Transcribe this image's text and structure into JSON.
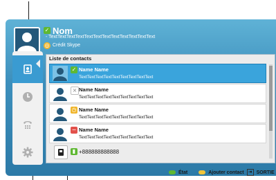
{
  "profile": {
    "name": "Nom",
    "mood": "- TextTextTextTextTextTextTextTextTextTextTextText",
    "credit": "Crédit Skype"
  },
  "contacts": {
    "header": "Liste de contacts",
    "items": [
      {
        "name": "Name Name",
        "mood": "TextTextTextTextTextTextTextTextText",
        "status": "online"
      },
      {
        "name": "Name Name",
        "mood": "TextTextTextTextTextTextTextTextText",
        "status": "offline"
      },
      {
        "name": "Name Name",
        "mood": "TextTextTextTextTextTextTextTextText",
        "status": "away"
      },
      {
        "name": "Name Name",
        "mood": "TextTextTextTextTextTextTextTextText",
        "status": "busy"
      }
    ],
    "phone": "+888888888888"
  },
  "sidebar": [
    "contacts-icon",
    "history-icon",
    "dialpad-icon",
    "settings-icon"
  ],
  "bottom": {
    "status_label": "État",
    "add_label": "Ajouter contact",
    "exit_label": "SORTIE"
  },
  "colors": {
    "accent": "#3aa4dc",
    "online": "#5fb832",
    "offline": "#b5b5b5",
    "away": "#f0b52a",
    "busy": "#e2514b"
  }
}
